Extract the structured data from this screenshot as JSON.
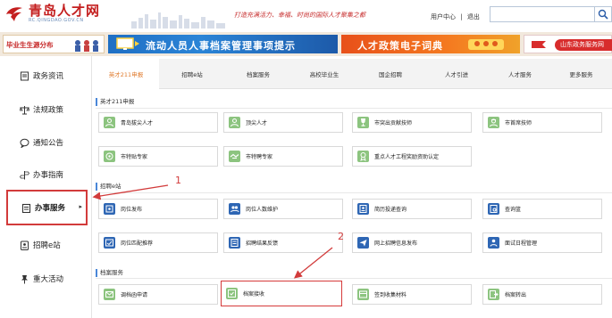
{
  "header": {
    "logo_title": "青岛人才网",
    "logo_url": "RC.QINGDAO.GOV.CN",
    "slogan": "打造充满活力、幸福、时尚的国际人才聚集之都",
    "user_center": "用户中心",
    "separator": "|",
    "logout": "退出",
    "search_value": "",
    "search_icon": "search-icon"
  },
  "banner": {
    "b1_text": "毕业生生源分布",
    "b2_text": "流动人员人事档案管理事项提示",
    "b3_text": "人才政策电子词典",
    "b4_text": "山东政务服务网"
  },
  "sidebar": {
    "items": [
      {
        "label": "政务资讯",
        "icon": "document-icon"
      },
      {
        "label": "法规政策",
        "icon": "scale-icon"
      },
      {
        "label": "通知公告",
        "icon": "chat-bubble-icon"
      },
      {
        "label": "办事指南",
        "icon": "signpost-icon"
      },
      {
        "label": "办事服务",
        "icon": "clipboard-icon",
        "active": true
      },
      {
        "label": "招聘e站",
        "icon": "badge-icon"
      },
      {
        "label": "重大活动",
        "icon": "pin-icon"
      }
    ]
  },
  "tabs": [
    {
      "label": "英才211申报",
      "active": true
    },
    {
      "label": "招聘e站"
    },
    {
      "label": "档案服务"
    },
    {
      "label": "高校毕业生"
    },
    {
      "label": "国企招聘"
    },
    {
      "label": "人才引进"
    },
    {
      "label": "人才服务"
    },
    {
      "label": "更多服务"
    }
  ],
  "sections": {
    "s1_title": "英才211申报",
    "s1_cards": [
      "青岛拔尖人才",
      "顶尖人才",
      "市突出贡献技师",
      "市首席技师",
      "市特贴专家",
      "市特聘专家",
      "重点人才工程奖励资助认定"
    ],
    "s2_title": "招聘e站",
    "s2_cards": [
      "岗位发布",
      "岗位人数维护",
      "简历投递查询",
      "查询篮",
      "岗位匹配推荐",
      "招聘结果反馈",
      "网上招聘信息发布",
      "面试日程管理"
    ],
    "s3_title": "档案服务",
    "s3_cards": [
      "调档函申请",
      "档案接收",
      "签到收集材料",
      "档案转出"
    ]
  },
  "annotations": {
    "num1": "1",
    "num2": "2"
  },
  "colors": {
    "accent_red": "#d23b3b",
    "tab_active": "#e07a2c",
    "section_bar": "#4a87d8",
    "icon_green": "#8cc47f",
    "icon_blue": "#2e66b4"
  }
}
